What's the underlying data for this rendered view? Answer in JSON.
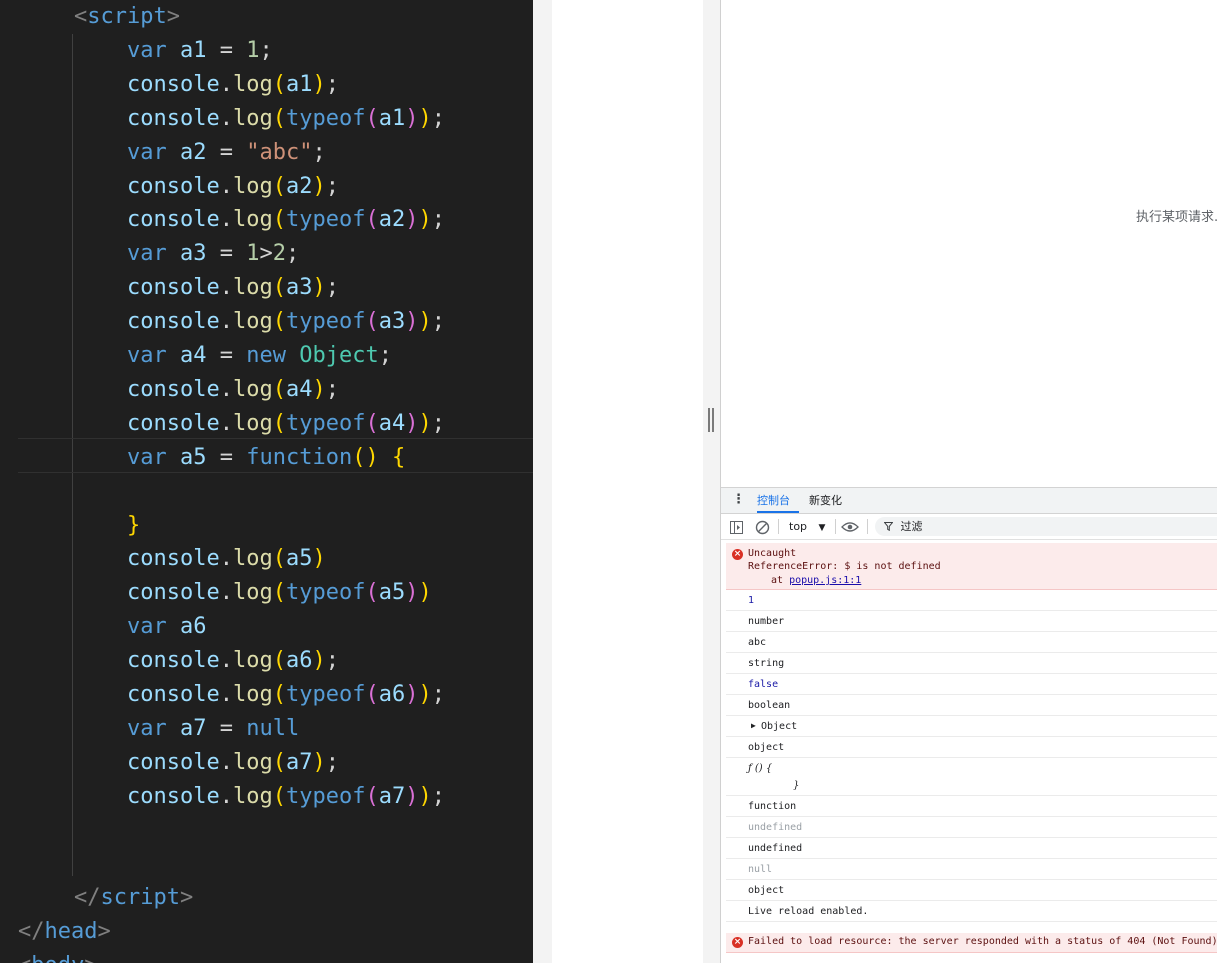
{
  "editor": {
    "lines": [
      [
        {
          "c": "tk-tag",
          "t": "<"
        },
        {
          "c": "tk-tagname",
          "t": "script"
        },
        {
          "c": "tk-tag",
          "t": ">"
        }
      ],
      [
        {
          "c": "tk-kw",
          "t": "var"
        },
        {
          "c": "tk-op",
          "t": " "
        },
        {
          "c": "tk-var",
          "t": "a1"
        },
        {
          "c": "tk-op",
          "t": " = "
        },
        {
          "c": "tk-num",
          "t": "1"
        },
        {
          "c": "tk-op",
          "t": ";"
        }
      ],
      [
        {
          "c": "tk-var",
          "t": "console"
        },
        {
          "c": "tk-op",
          "t": "."
        },
        {
          "c": "tk-fn",
          "t": "log"
        },
        {
          "c": "tk-p1",
          "t": "("
        },
        {
          "c": "tk-var",
          "t": "a1"
        },
        {
          "c": "tk-p1",
          "t": ")"
        },
        {
          "c": "tk-op",
          "t": ";"
        }
      ],
      [
        {
          "c": "tk-var",
          "t": "console"
        },
        {
          "c": "tk-op",
          "t": "."
        },
        {
          "c": "tk-fn",
          "t": "log"
        },
        {
          "c": "tk-p1",
          "t": "("
        },
        {
          "c": "tk-kw",
          "t": "typeof"
        },
        {
          "c": "tk-p2",
          "t": "("
        },
        {
          "c": "tk-var",
          "t": "a1"
        },
        {
          "c": "tk-p2",
          "t": ")"
        },
        {
          "c": "tk-p1",
          "t": ")"
        },
        {
          "c": "tk-op",
          "t": ";"
        }
      ],
      [
        {
          "c": "tk-kw",
          "t": "var"
        },
        {
          "c": "tk-op",
          "t": " "
        },
        {
          "c": "tk-var",
          "t": "a2"
        },
        {
          "c": "tk-op",
          "t": " = "
        },
        {
          "c": "tk-str",
          "t": "\"abc\""
        },
        {
          "c": "tk-op",
          "t": ";"
        }
      ],
      [
        {
          "c": "tk-var",
          "t": "console"
        },
        {
          "c": "tk-op",
          "t": "."
        },
        {
          "c": "tk-fn",
          "t": "log"
        },
        {
          "c": "tk-p1",
          "t": "("
        },
        {
          "c": "tk-var",
          "t": "a2"
        },
        {
          "c": "tk-p1",
          "t": ")"
        },
        {
          "c": "tk-op",
          "t": ";"
        }
      ],
      [
        {
          "c": "tk-var",
          "t": "console"
        },
        {
          "c": "tk-op",
          "t": "."
        },
        {
          "c": "tk-fn",
          "t": "log"
        },
        {
          "c": "tk-p1",
          "t": "("
        },
        {
          "c": "tk-kw",
          "t": "typeof"
        },
        {
          "c": "tk-p2",
          "t": "("
        },
        {
          "c": "tk-var",
          "t": "a2"
        },
        {
          "c": "tk-p2",
          "t": ")"
        },
        {
          "c": "tk-p1",
          "t": ")"
        },
        {
          "c": "tk-op",
          "t": ";"
        }
      ],
      [
        {
          "c": "tk-kw",
          "t": "var"
        },
        {
          "c": "tk-op",
          "t": " "
        },
        {
          "c": "tk-var",
          "t": "a3"
        },
        {
          "c": "tk-op",
          "t": " = "
        },
        {
          "c": "tk-num",
          "t": "1"
        },
        {
          "c": "tk-op",
          "t": ">"
        },
        {
          "c": "tk-num",
          "t": "2"
        },
        {
          "c": "tk-op",
          "t": ";"
        }
      ],
      [
        {
          "c": "tk-var",
          "t": "console"
        },
        {
          "c": "tk-op",
          "t": "."
        },
        {
          "c": "tk-fn",
          "t": "log"
        },
        {
          "c": "tk-p1",
          "t": "("
        },
        {
          "c": "tk-var",
          "t": "a3"
        },
        {
          "c": "tk-p1",
          "t": ")"
        },
        {
          "c": "tk-op",
          "t": ";"
        }
      ],
      [
        {
          "c": "tk-var",
          "t": "console"
        },
        {
          "c": "tk-op",
          "t": "."
        },
        {
          "c": "tk-fn",
          "t": "log"
        },
        {
          "c": "tk-p1",
          "t": "("
        },
        {
          "c": "tk-kw",
          "t": "typeof"
        },
        {
          "c": "tk-p2",
          "t": "("
        },
        {
          "c": "tk-var",
          "t": "a3"
        },
        {
          "c": "tk-p2",
          "t": ")"
        },
        {
          "c": "tk-p1",
          "t": ")"
        },
        {
          "c": "tk-op",
          "t": ";"
        }
      ],
      [
        {
          "c": "tk-kw",
          "t": "var"
        },
        {
          "c": "tk-op",
          "t": " "
        },
        {
          "c": "tk-var",
          "t": "a4"
        },
        {
          "c": "tk-op",
          "t": " = "
        },
        {
          "c": "tk-kw",
          "t": "new"
        },
        {
          "c": "tk-op",
          "t": " "
        },
        {
          "c": "tk-cls",
          "t": "Object"
        },
        {
          "c": "tk-op",
          "t": ";"
        }
      ],
      [
        {
          "c": "tk-var",
          "t": "console"
        },
        {
          "c": "tk-op",
          "t": "."
        },
        {
          "c": "tk-fn",
          "t": "log"
        },
        {
          "c": "tk-p1",
          "t": "("
        },
        {
          "c": "tk-var",
          "t": "a4"
        },
        {
          "c": "tk-p1",
          "t": ")"
        },
        {
          "c": "tk-op",
          "t": ";"
        }
      ],
      [
        {
          "c": "tk-var",
          "t": "console"
        },
        {
          "c": "tk-op",
          "t": "."
        },
        {
          "c": "tk-fn",
          "t": "log"
        },
        {
          "c": "tk-p1",
          "t": "("
        },
        {
          "c": "tk-kw",
          "t": "typeof"
        },
        {
          "c": "tk-p2",
          "t": "("
        },
        {
          "c": "tk-var",
          "t": "a4"
        },
        {
          "c": "tk-p2",
          "t": ")"
        },
        {
          "c": "tk-p1",
          "t": ")"
        },
        {
          "c": "tk-op",
          "t": ";"
        }
      ],
      [
        {
          "c": "tk-kw",
          "t": "var"
        },
        {
          "c": "tk-op",
          "t": " "
        },
        {
          "c": "tk-var",
          "t": "a5"
        },
        {
          "c": "tk-op",
          "t": " = "
        },
        {
          "c": "tk-kw",
          "t": "function"
        },
        {
          "c": "tk-p1",
          "t": "()"
        },
        {
          "c": "tk-op",
          "t": " "
        },
        {
          "c": "tk-p1",
          "t": "{"
        }
      ],
      [],
      [
        {
          "c": "tk-p1",
          "t": "}"
        }
      ],
      [
        {
          "c": "tk-var",
          "t": "console"
        },
        {
          "c": "tk-op",
          "t": "."
        },
        {
          "c": "tk-fn",
          "t": "log"
        },
        {
          "c": "tk-p1",
          "t": "("
        },
        {
          "c": "tk-var",
          "t": "a5"
        },
        {
          "c": "tk-p1",
          "t": ")"
        }
      ],
      [
        {
          "c": "tk-var",
          "t": "console"
        },
        {
          "c": "tk-op",
          "t": "."
        },
        {
          "c": "tk-fn",
          "t": "log"
        },
        {
          "c": "tk-p1",
          "t": "("
        },
        {
          "c": "tk-kw",
          "t": "typeof"
        },
        {
          "c": "tk-p2",
          "t": "("
        },
        {
          "c": "tk-var",
          "t": "a5"
        },
        {
          "c": "tk-p2",
          "t": ")"
        },
        {
          "c": "tk-p1",
          "t": ")"
        }
      ],
      [
        {
          "c": "tk-kw",
          "t": "var"
        },
        {
          "c": "tk-op",
          "t": " "
        },
        {
          "c": "tk-var",
          "t": "a6"
        }
      ],
      [
        {
          "c": "tk-var",
          "t": "console"
        },
        {
          "c": "tk-op",
          "t": "."
        },
        {
          "c": "tk-fn",
          "t": "log"
        },
        {
          "c": "tk-p1",
          "t": "("
        },
        {
          "c": "tk-var",
          "t": "a6"
        },
        {
          "c": "tk-p1",
          "t": ")"
        },
        {
          "c": "tk-op",
          "t": ";"
        }
      ],
      [
        {
          "c": "tk-var",
          "t": "console"
        },
        {
          "c": "tk-op",
          "t": "."
        },
        {
          "c": "tk-fn",
          "t": "log"
        },
        {
          "c": "tk-p1",
          "t": "("
        },
        {
          "c": "tk-kw",
          "t": "typeof"
        },
        {
          "c": "tk-p2",
          "t": "("
        },
        {
          "c": "tk-var",
          "t": "a6"
        },
        {
          "c": "tk-p2",
          "t": ")"
        },
        {
          "c": "tk-p1",
          "t": ")"
        },
        {
          "c": "tk-op",
          "t": ";"
        }
      ],
      [
        {
          "c": "tk-kw",
          "t": "var"
        },
        {
          "c": "tk-op",
          "t": " "
        },
        {
          "c": "tk-var",
          "t": "a7"
        },
        {
          "c": "tk-op",
          "t": " = "
        },
        {
          "c": "tk-kw",
          "t": "null"
        }
      ],
      [
        {
          "c": "tk-var",
          "t": "console"
        },
        {
          "c": "tk-op",
          "t": "."
        },
        {
          "c": "tk-fn",
          "t": "log"
        },
        {
          "c": "tk-p1",
          "t": "("
        },
        {
          "c": "tk-var",
          "t": "a7"
        },
        {
          "c": "tk-p1",
          "t": ")"
        },
        {
          "c": "tk-op",
          "t": ";"
        }
      ],
      [
        {
          "c": "tk-var",
          "t": "console"
        },
        {
          "c": "tk-op",
          "t": "."
        },
        {
          "c": "tk-fn",
          "t": "log"
        },
        {
          "c": "tk-p1",
          "t": "("
        },
        {
          "c": "tk-kw",
          "t": "typeof"
        },
        {
          "c": "tk-p2",
          "t": "("
        },
        {
          "c": "tk-var",
          "t": "a7"
        },
        {
          "c": "tk-p2",
          "t": ")"
        },
        {
          "c": "tk-p1",
          "t": ")"
        },
        {
          "c": "tk-op",
          "t": ";"
        }
      ],
      [],
      [],
      [
        {
          "c": "tk-tag",
          "t": "</"
        },
        {
          "c": "tk-tagname",
          "t": "script"
        },
        {
          "c": "tk-tag",
          "t": ">"
        }
      ],
      [
        {
          "c": "tk-tag",
          "t": "</"
        },
        {
          "c": "tk-tagname",
          "t": "head"
        },
        {
          "c": "tk-tag",
          "t": ">"
        }
      ],
      [
        {
          "c": "tk-tag",
          "t": "<"
        },
        {
          "c": "tk-tagname",
          "t": "body"
        },
        {
          "c": "tk-tag",
          "t": ">"
        }
      ]
    ]
  },
  "page": {
    "loading_text": "执行某项请求..."
  },
  "devtools": {
    "menu_icon": "kebab-menu-icon",
    "tabs": [
      {
        "label": "控制台",
        "active": true
      },
      {
        "label": "新变化",
        "active": false
      }
    ],
    "toolbar": {
      "context": "top",
      "filter_label": "过滤"
    },
    "console": {
      "error1": {
        "line1": "Uncaught",
        "line2": "ReferenceError: $ is not defined",
        "line3_prefix": "at ",
        "line3_link": "popup.js:1:1"
      },
      "logs": [
        {
          "text": "1",
          "style": "num"
        },
        {
          "text": "number",
          "style": ""
        },
        {
          "text": "abc",
          "style": ""
        },
        {
          "text": "string",
          "style": ""
        },
        {
          "text": "false",
          "style": "bool"
        },
        {
          "text": "boolean",
          "style": ""
        },
        {
          "text": "Object",
          "style": "obj"
        },
        {
          "text": "object",
          "style": ""
        },
        {
          "text": "ƒ () {",
          "text2": "}",
          "style": "fn"
        },
        {
          "text": "function",
          "style": ""
        },
        {
          "text": "undefined",
          "style": "dim"
        },
        {
          "text": "undefined",
          "style": ""
        },
        {
          "text": "null",
          "style": "dim"
        },
        {
          "text": "object",
          "style": ""
        },
        {
          "text": "Live reload enabled.",
          "style": ""
        }
      ],
      "error2": "Failed to load resource: the server responded with a status of 404 (Not Found)"
    }
  }
}
